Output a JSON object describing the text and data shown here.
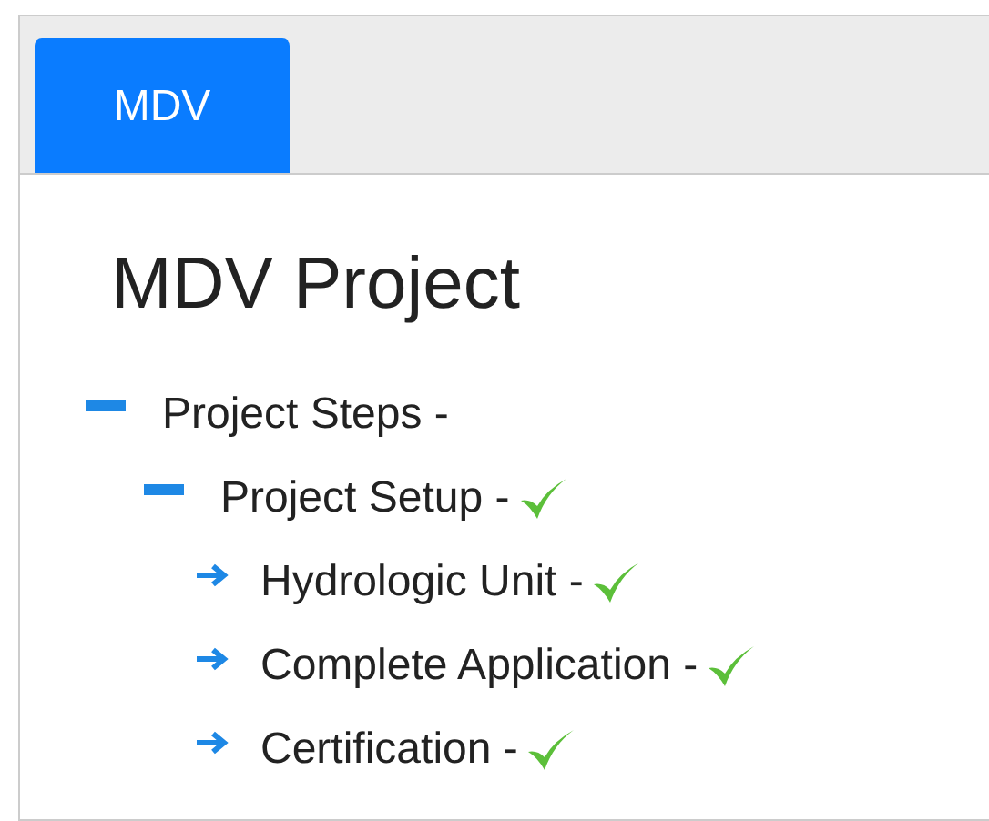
{
  "tabs": [
    {
      "label": "MDV",
      "selected": true
    }
  ],
  "title": "MDV Project",
  "tree": [
    {
      "label": "Project Steps -",
      "complete": false,
      "expanded": true,
      "children": [
        {
          "label": "Project Setup -",
          "complete": true,
          "expanded": true,
          "children": [
            {
              "label": "Hydrologic Unit -",
              "complete": true
            },
            {
              "label": "Complete Application -",
              "complete": true
            },
            {
              "label": "Certification -",
              "complete": true
            }
          ]
        }
      ]
    }
  ]
}
